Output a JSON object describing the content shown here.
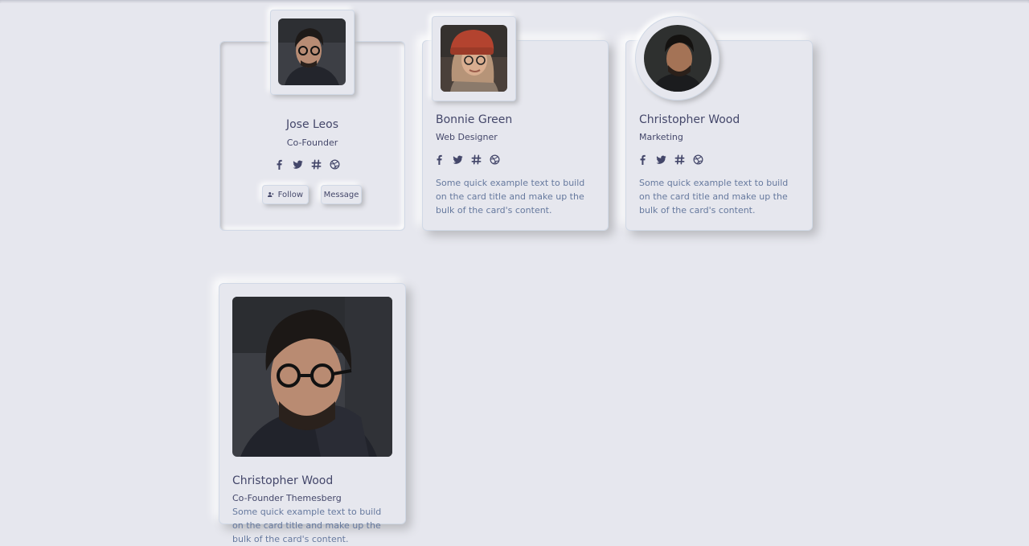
{
  "cards": [
    {
      "name": "Jose Leos",
      "role": "Co-Founder",
      "social_icons": [
        "facebook-icon",
        "twitter-icon",
        "slack-icon",
        "dribbble-icon"
      ],
      "buttons": {
        "follow": "Follow",
        "message": "Message"
      }
    },
    {
      "name": "Bonnie Green",
      "role": "Web Designer",
      "social_icons": [
        "facebook-icon",
        "twitter-icon",
        "slack-icon",
        "dribbble-icon"
      ],
      "description": "Some quick example text to build on the card title and make up the bulk of the card's content."
    },
    {
      "name": "Christopher Wood",
      "role": "Marketing",
      "social_icons": [
        "facebook-icon",
        "twitter-icon",
        "slack-icon",
        "dribbble-icon"
      ],
      "description": "Some quick example text to build on the card title and make up the bulk of the card's content."
    },
    {
      "name": "Christopher Wood",
      "role": "Co-Founder Themesberg",
      "description": "Some quick example text to build on the card title and make up the bulk of the card's content."
    }
  ],
  "colors": {
    "background": "#e6e7ee",
    "text": "#44476a",
    "muted": "#66799e",
    "shadow_dark": "#b8b9be",
    "shadow_light": "#ffffff"
  }
}
